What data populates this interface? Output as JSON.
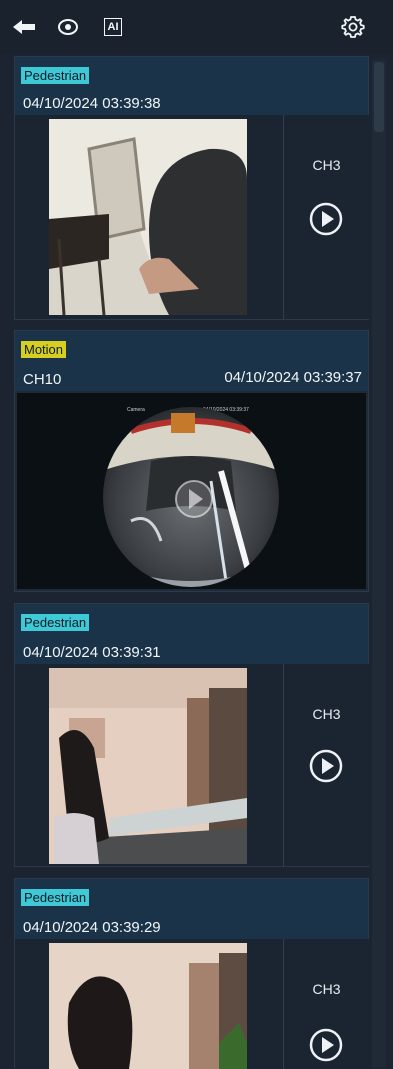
{
  "toolbar": {
    "back_icon": "back-arrow-icon",
    "view_icon": "eye-icon",
    "ai_icon": "ai-icon",
    "ai_text": "AI",
    "settings_icon": "gear-icon"
  },
  "events": [
    {
      "tag": "Pedestrian",
      "tag_color": "#3fc9d7",
      "timestamp": "04/10/2024 03:39:38",
      "channel": "CH3"
    },
    {
      "tag": "Motion",
      "tag_color": "#d6cf22",
      "channel": "CH10",
      "timestamp": "04/10/2024 03:39:37",
      "overlay_camera": "Camera",
      "overlay_time": "04/10/2024 03:39:37"
    },
    {
      "tag": "Pedestrian",
      "tag_color": "#3fc9d7",
      "timestamp": "04/10/2024 03:39:31",
      "channel": "CH3"
    },
    {
      "tag": "Pedestrian",
      "tag_color": "#3fc9d7",
      "timestamp": "04/10/2024 03:39:29",
      "channel": "CH3"
    }
  ]
}
